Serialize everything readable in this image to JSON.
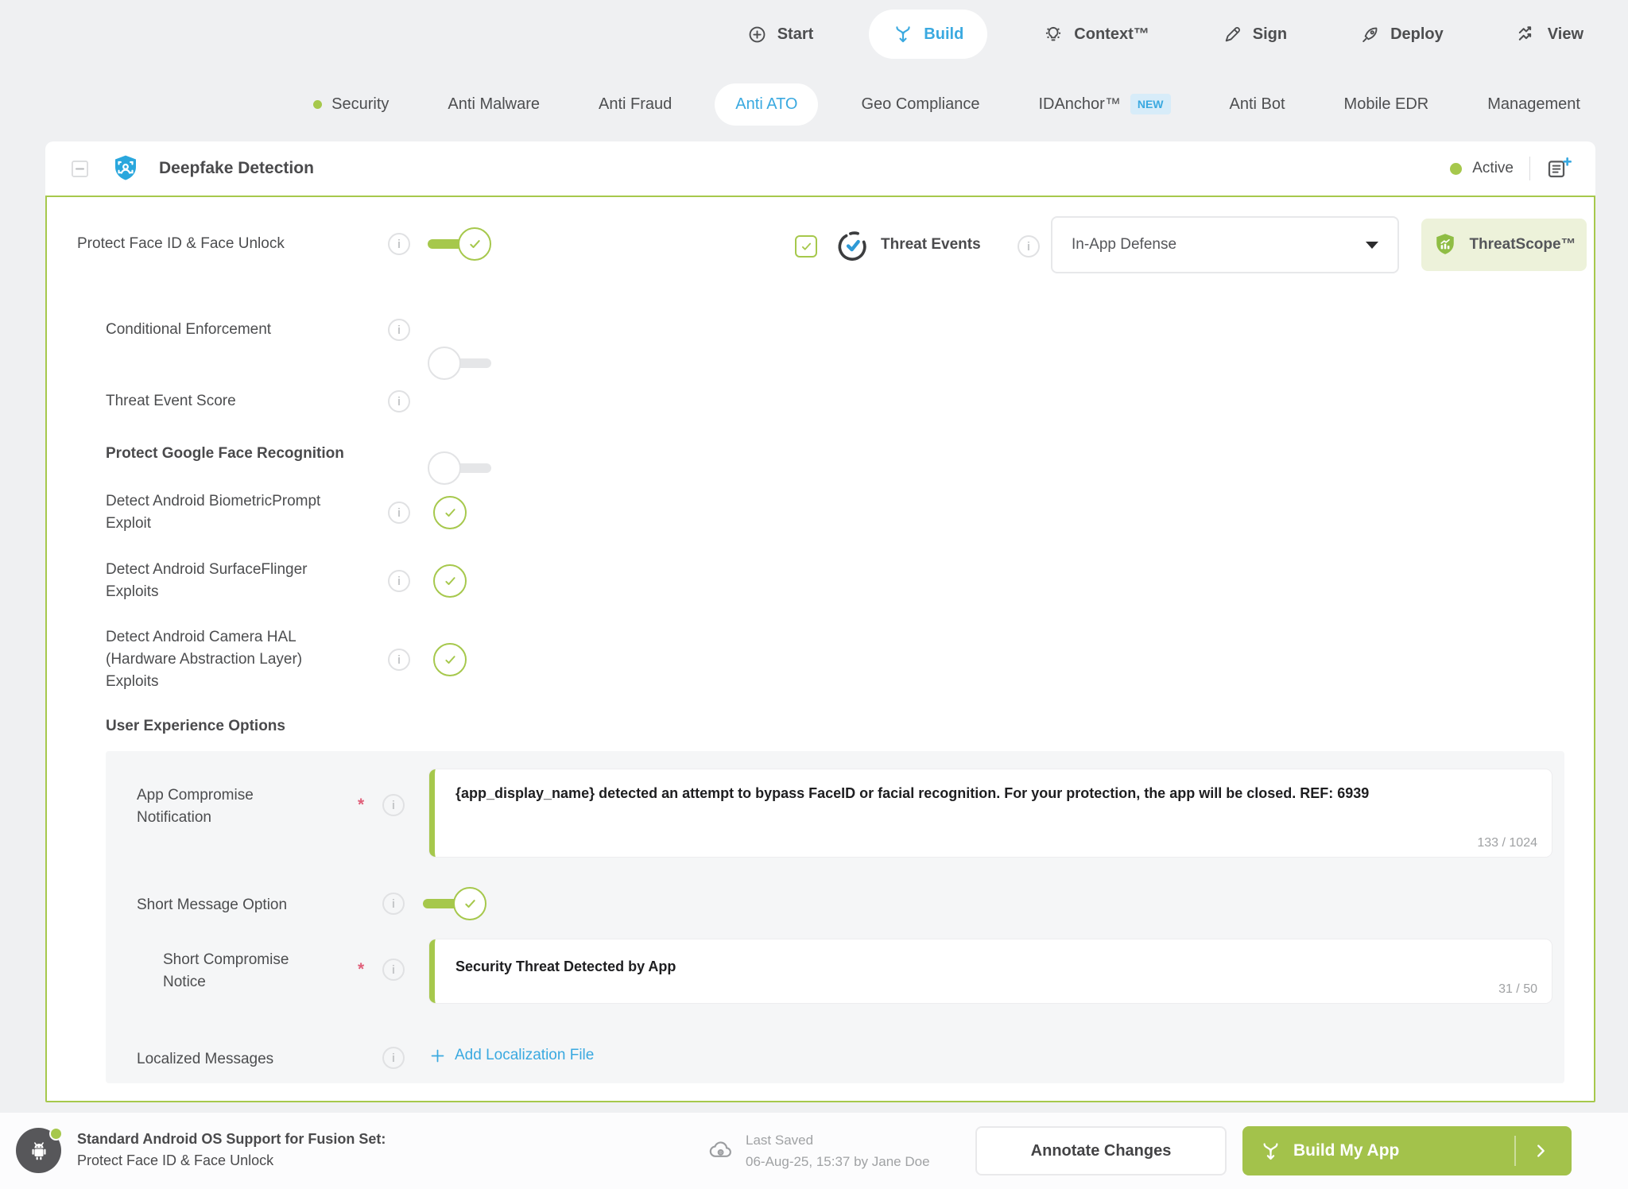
{
  "colors": {
    "accent_green": "#a6c84c",
    "accent_blue": "#3aa9e0"
  },
  "top_nav": {
    "items": [
      {
        "label": "Start"
      },
      {
        "label": "Build",
        "active": true
      },
      {
        "label": "Context™"
      },
      {
        "label": "Sign"
      },
      {
        "label": "Deploy"
      },
      {
        "label": "View"
      }
    ]
  },
  "sub_nav": {
    "items": [
      {
        "label": "Security",
        "status_dot": true
      },
      {
        "label": "Anti Malware"
      },
      {
        "label": "Anti Fraud"
      },
      {
        "label": "Anti ATO",
        "active": true
      },
      {
        "label": "Geo Compliance"
      },
      {
        "label": "IDAnchor™",
        "badge": "NEW"
      },
      {
        "label": "Anti Bot"
      },
      {
        "label": "Mobile EDR"
      },
      {
        "label": "Management"
      }
    ]
  },
  "panel": {
    "title": "Deepfake Detection",
    "status": "Active",
    "protect_face": {
      "label": "Protect Face ID & Face Unlock",
      "toggle": "on"
    },
    "threat_events": {
      "label": "Threat Events",
      "checked": true,
      "dropdown_value": "In-App Defense",
      "threatscope_label": "ThreatScope™"
    },
    "conditional_enforcement": {
      "label": "Conditional Enforcement",
      "toggle": "off"
    },
    "threat_event_score": {
      "label": "Threat Event Score",
      "toggle": "off"
    },
    "google_face": {
      "heading": "Protect Google Face Recognition",
      "items": [
        {
          "label": "Detect Android BiometricPrompt Exploit",
          "checked": true
        },
        {
          "label": "Detect Android SurfaceFlinger Exploits",
          "checked": true
        },
        {
          "label": "Detect Android Camera HAL (Hardware Abstraction Layer) Exploits",
          "checked": true
        }
      ]
    },
    "ux": {
      "heading": "User Experience Options",
      "app_compromise": {
        "label": "App Compromise Notification",
        "required": "*",
        "value": "{app_display_name} detected an attempt to bypass FaceID or facial recognition. For your protection, the app will be closed. REF: 6939",
        "counter": "133 / 1024"
      },
      "short_message_option": {
        "label": "Short Message Option",
        "toggle": "on"
      },
      "short_compromise": {
        "label": "Short Compromise Notice",
        "required": "*",
        "value": "Security Threat Detected by App",
        "counter": "31 / 50"
      },
      "localized": {
        "label": "Localized Messages",
        "link": "Add Localization File"
      }
    }
  },
  "footer": {
    "fusion_label": "Standard Android OS Support for Fusion Set:",
    "fusion_value": "Protect Face ID & Face Unlock",
    "last_saved_label": "Last Saved",
    "last_saved_value": "06-Aug-25, 15:37 by Jane Doe",
    "annotate_button": "Annotate Changes",
    "build_button": "Build My App"
  }
}
